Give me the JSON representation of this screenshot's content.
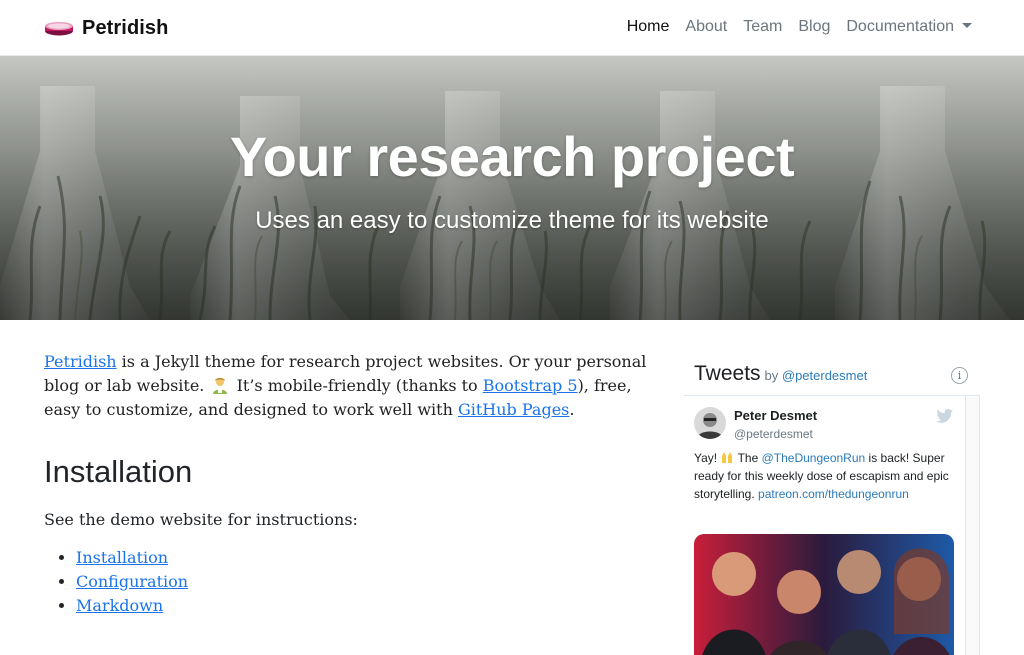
{
  "nav": {
    "brand": "Petridish",
    "items": [
      {
        "label": "Home",
        "active": true
      },
      {
        "label": "About",
        "active": false
      },
      {
        "label": "Team",
        "active": false
      },
      {
        "label": "Blog",
        "active": false
      },
      {
        "label": "Documentation",
        "active": false,
        "dropdown": true
      }
    ]
  },
  "hero": {
    "title": "Your research project",
    "subtitle": "Uses an easy to customize theme for its website"
  },
  "intro": {
    "link_petridish": "Petridish",
    "text_1": " is a Jekyll theme for research project websites. Or your personal blog or lab website. ",
    "emoji": "scientist-emoji",
    "text_2": " It’s mobile-friendly (thanks to ",
    "link_bootstrap": "Bootstrap 5",
    "text_3": "), free, easy to customize, and designed to work well with ",
    "link_github": "GitHub Pages",
    "text_4": "."
  },
  "installation": {
    "heading": "Installation",
    "text": "See the demo website for instructions:",
    "links": [
      "Installation",
      "Configuration",
      "Markdown"
    ]
  },
  "twitter": {
    "title": "Tweets",
    "by": "by ",
    "handle": "@peterdesmet",
    "info": "i",
    "tweet": {
      "name": "Peter Desmet",
      "handle": "@peterdesmet",
      "text_1": "Yay! ",
      "emoji": "raised-hands-emoji",
      "text_2": " The ",
      "mention": "@TheDungeonRun",
      "text_3": " is back! Super ready for this weekly dose of escapism and epic storytelling. ",
      "link": "patreon.com/thedungeonrun"
    }
  },
  "colors": {
    "link": "#1a73e8",
    "twitter_link": "#2b7bb9",
    "brand_dish": "#c2185b"
  }
}
